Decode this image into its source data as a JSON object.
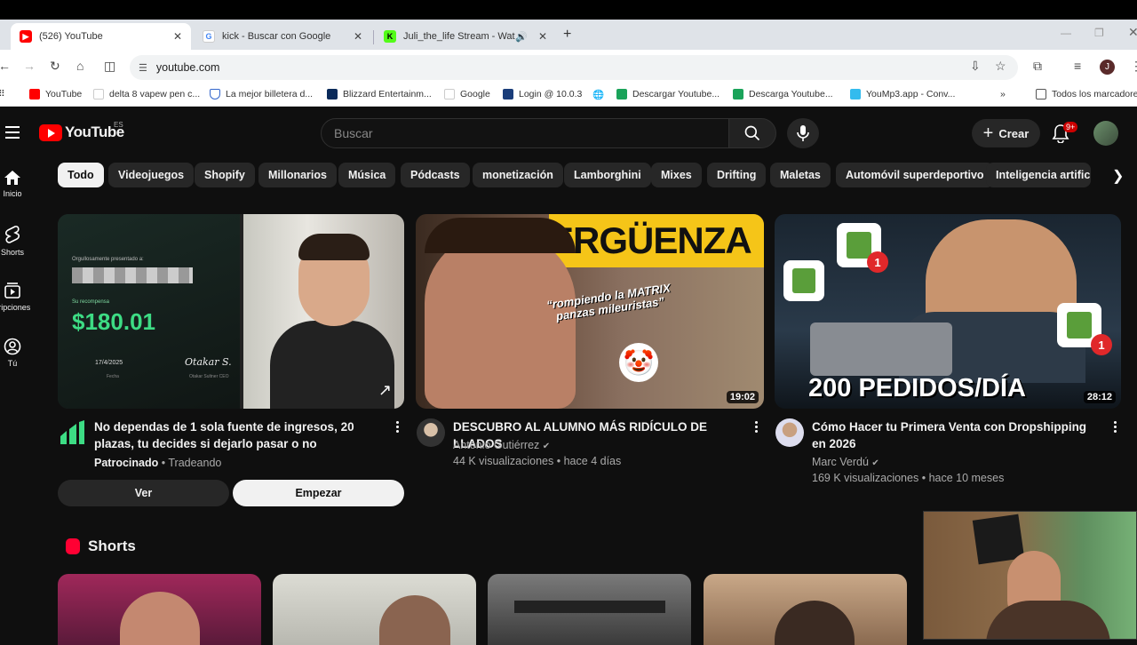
{
  "browser": {
    "tabs": [
      {
        "title": "(526) YouTube",
        "active": true
      },
      {
        "title": "kick - Buscar con Google",
        "active": false
      },
      {
        "title": "Juli_the_life Stream - Watch",
        "active": false
      }
    ],
    "url": "youtube.com",
    "profile_initial": "J",
    "bookmarks": [
      "YouTube",
      "delta 8 vapew pen c...",
      "La mejor billetera d...",
      "Blizzard Entertainm...",
      "Google",
      "Login @ 10.0.3",
      "Descargar Youtube...",
      "Descarga Youtube...",
      "YouMp3.app - Conv...",
      "Todos los marcadores"
    ]
  },
  "header": {
    "logo_text": "YouTube",
    "country_code": "ES",
    "search_placeholder": "Buscar",
    "create_label": "Crear",
    "notif_badge": "9+"
  },
  "sidebar": {
    "items": [
      {
        "label": "Inicio",
        "icon": "home-icon"
      },
      {
        "label": "Shorts",
        "icon": "shorts-icon"
      },
      {
        "label": "cripciones",
        "icon": "subscriptions-icon"
      },
      {
        "label": "Tú",
        "icon": "you-icon"
      }
    ]
  },
  "chips": [
    "Todo",
    "Videojuegos",
    "Shopify",
    "Millonarios",
    "Música",
    "Pódcasts",
    "monetización",
    "Lamborghini",
    "Mixes",
    "Drifting",
    "Maletas",
    "Automóvil superdeportivo",
    "Inteligencia artificia"
  ],
  "videos": [
    {
      "title": "No dependas de 1 sola fuente de ingresos, 20 plazas, tu decides si dejarlo pasar o no",
      "sponsored": "Patrocinado",
      "channel": "Tradeando",
      "ad_card": {
        "presented": "Orgullosamente presentado a:",
        "reward_label": "Su recompensa",
        "amount": "$180.01",
        "date": "17/4/2025",
        "date_label": "Fecha",
        "signature": "Otakar S.",
        "signer": "Otakar Sultner CEO"
      },
      "btn_view": "Ver",
      "btn_start": "Empezar"
    },
    {
      "title": "DESCUBRO AL ALUMNO MÁS RIDÍCULO DE LLADOS",
      "channel": "Antonio Gutiérrez",
      "views": "44 K visualizaciones",
      "age": "hace 4 días",
      "duration": "19:02",
      "thumb_text_top": "ERGÜENZA",
      "thumb_text_mid": "“rompiendo la MATRIX panzas mileuristas”"
    },
    {
      "title": "Cómo Hacer tu Primera Venta con Dropshipping en 2026",
      "channel": "Marc Verdú",
      "views": "169 K visualizaciones",
      "age": "hace 10 meses",
      "duration": "28:12",
      "thumb_text": "200 PEDIDOS/DÍA"
    }
  ],
  "shorts": {
    "heading": "Shorts"
  },
  "colors": {
    "yt_red": "#ff0000",
    "bg": "#0f0f0f",
    "chip_bg": "#272727"
  }
}
